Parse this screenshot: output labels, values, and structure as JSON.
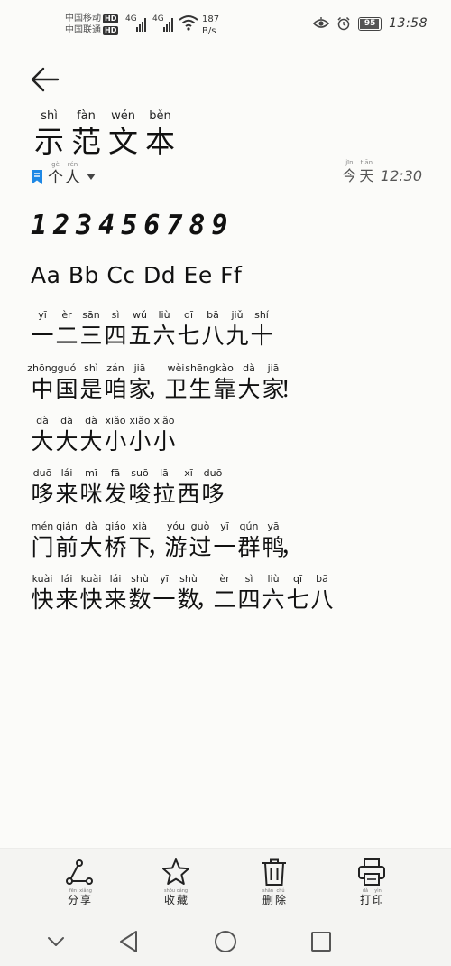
{
  "status_bar": {
    "carrier1": "中国移动",
    "carrier2": "中国联通",
    "hd_badge": "HD",
    "network1": "4G",
    "network2": "4G",
    "speed_value": "187",
    "speed_unit": "B/s",
    "battery": "95",
    "battery_fraction": 0.95,
    "time": "13:58"
  },
  "header": {
    "title": [
      {
        "py": "shì",
        "hz": "示"
      },
      {
        "py": "fàn",
        "hz": "范"
      },
      {
        "py": "wén",
        "hz": "文"
      },
      {
        "py": "běn",
        "hz": "本"
      }
    ],
    "category": [
      {
        "py": "gè",
        "hz": "个"
      },
      {
        "py": "rén",
        "hz": "人"
      }
    ],
    "date_label": [
      {
        "py": "jīn",
        "hz": "今"
      },
      {
        "py": "tiān",
        "hz": "天"
      }
    ],
    "time": "12:30"
  },
  "content": {
    "digits": "123456789",
    "latin": "Aa Bb Cc Dd Ee Ff",
    "lines": [
      [
        {
          "py": "yī",
          "hz": "一"
        },
        {
          "py": "èr",
          "hz": "二"
        },
        {
          "py": "sān",
          "hz": "三"
        },
        {
          "py": "sì",
          "hz": "四"
        },
        {
          "py": "wǔ",
          "hz": "五"
        },
        {
          "py": "liù",
          "hz": "六"
        },
        {
          "py": "qī",
          "hz": "七"
        },
        {
          "py": "bā",
          "hz": "八"
        },
        {
          "py": "jiǔ",
          "hz": "九"
        },
        {
          "py": "shí",
          "hz": "十"
        }
      ],
      [
        {
          "py": "zhōng",
          "hz": "中"
        },
        {
          "py": "guó",
          "hz": "国"
        },
        {
          "py": "shì",
          "hz": "是"
        },
        {
          "py": "zán",
          "hz": "咱"
        },
        {
          "py": "jiā",
          "hz": "家"
        },
        {
          "py": "",
          "hz": "，"
        },
        {
          "py": "wèi",
          "hz": "卫"
        },
        {
          "py": "shēng",
          "hz": "生"
        },
        {
          "py": "kào",
          "hz": "靠"
        },
        {
          "py": "dà",
          "hz": "大"
        },
        {
          "py": "jiā",
          "hz": "家"
        },
        {
          "py": "",
          "hz": "！"
        }
      ],
      [
        {
          "py": "dà",
          "hz": "大"
        },
        {
          "py": "dà",
          "hz": "大"
        },
        {
          "py": "dà",
          "hz": "大"
        },
        {
          "py": "xiǎo",
          "hz": "小"
        },
        {
          "py": "xiǎo",
          "hz": "小"
        },
        {
          "py": "xiǎo",
          "hz": "小"
        }
      ],
      [
        {
          "py": "duō",
          "hz": "哆"
        },
        {
          "py": "lái",
          "hz": "来"
        },
        {
          "py": "mī",
          "hz": "咪"
        },
        {
          "py": "fā",
          "hz": "发"
        },
        {
          "py": "suō",
          "hz": "唆"
        },
        {
          "py": "lā",
          "hz": "拉"
        },
        {
          "py": "xī",
          "hz": "西"
        },
        {
          "py": "duō",
          "hz": "哆"
        }
      ],
      [
        {
          "py": "mén",
          "hz": "门"
        },
        {
          "py": "qián",
          "hz": "前"
        },
        {
          "py": "dà",
          "hz": "大"
        },
        {
          "py": "qiáo",
          "hz": "桥"
        },
        {
          "py": "xià",
          "hz": "下"
        },
        {
          "py": "",
          "hz": "，"
        },
        {
          "py": "yóu",
          "hz": "游"
        },
        {
          "py": "guò",
          "hz": "过"
        },
        {
          "py": "yī",
          "hz": "一"
        },
        {
          "py": "qún",
          "hz": "群"
        },
        {
          "py": "yā",
          "hz": "鸭"
        },
        {
          "py": "",
          "hz": "，"
        }
      ],
      [
        {
          "py": "kuài",
          "hz": "快"
        },
        {
          "py": "lái",
          "hz": "来"
        },
        {
          "py": "kuài",
          "hz": "快"
        },
        {
          "py": "lái",
          "hz": "来"
        },
        {
          "py": "shù",
          "hz": "数"
        },
        {
          "py": "yī",
          "hz": "一"
        },
        {
          "py": "shù",
          "hz": "数"
        },
        {
          "py": "",
          "hz": "，"
        },
        {
          "py": "èr",
          "hz": "二"
        },
        {
          "py": "sì",
          "hz": "四"
        },
        {
          "py": "liù",
          "hz": "六"
        },
        {
          "py": "qī",
          "hz": "七"
        },
        {
          "py": "bā",
          "hz": "八"
        }
      ]
    ]
  },
  "toolbar": [
    {
      "icon": "share-icon",
      "label": [
        {
          "py": "fēn",
          "hz": "分"
        },
        {
          "py": "xiǎng",
          "hz": "享"
        }
      ]
    },
    {
      "icon": "star-icon",
      "label": [
        {
          "py": "shōu",
          "hz": "收"
        },
        {
          "py": "cáng",
          "hz": "藏"
        }
      ]
    },
    {
      "icon": "trash-icon",
      "label": [
        {
          "py": "shān",
          "hz": "删"
        },
        {
          "py": "chú",
          "hz": "除"
        }
      ]
    },
    {
      "icon": "printer-icon",
      "label": [
        {
          "py": "dǎ",
          "hz": "打"
        },
        {
          "py": "yìn",
          "hz": "印"
        }
      ]
    }
  ],
  "colors": {
    "background": "#fbfbf9",
    "bookmark_accent": "#1e88e5",
    "text": "#111111"
  }
}
